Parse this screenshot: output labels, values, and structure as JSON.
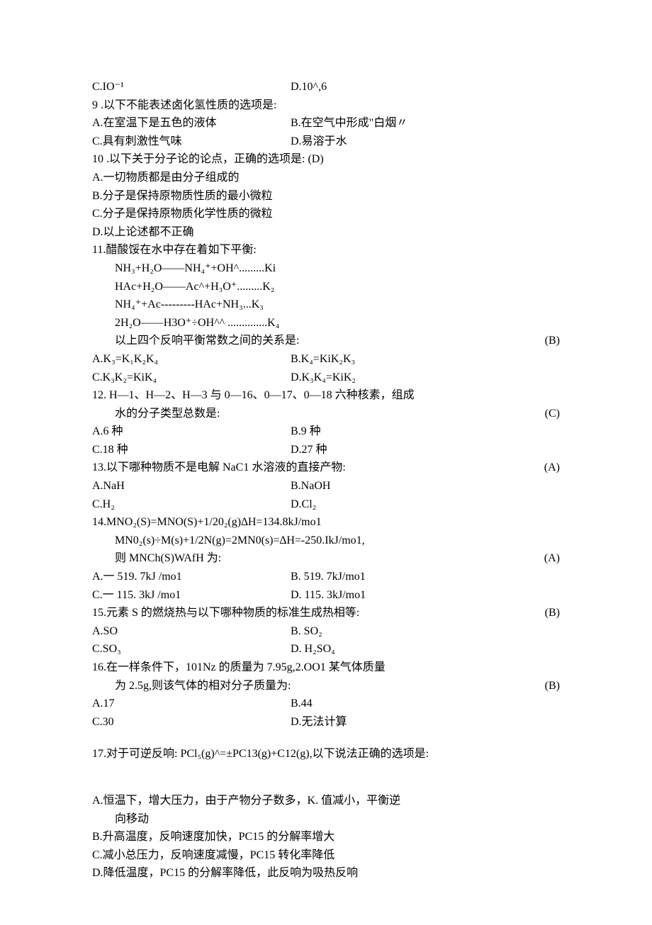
{
  "q8opt": {
    "c": "C.IO⁻¹",
    "d": "D.10^,6"
  },
  "q9": {
    "stem": "9 .以下不能表述卤化氢性质的选项是:",
    "a": "A.在室温下是五色的液体",
    "b": "B.在空气中形成\"白烟〃",
    "c": "C.具有刺激性气味",
    "d": "D.易溶于水"
  },
  "q10": {
    "stem": "10 .以下关于分子论的论点，正确的选项是: (D)",
    "a": "A.一切物质都是由分子组成的",
    "b": "B.分子是保持原物质性质的最小微粒",
    "c": "C.分子是保持原物质化学性质的微粒",
    "d": "D.以上论述都不正确"
  },
  "q11": {
    "stem": "11.醋酸馁在水中存在着如下平衡:",
    "e1": "NH₃+H₂O——NH₄⁺+OH^.........Ki",
    "e2": "HAc+H₂O——Ac^+H₃O⁺.........K₂",
    "e3": "NH₄⁺+Ac---------HAc+NH₃...K₃",
    "e4": "2H₂O——H3O⁺÷OH^^ ..............K₄",
    "rel": "以上四个反响平衡常数之间的关系是:",
    "a": "A.K₃=K₁K₂K₄",
    "b": "B.K₄=KiK₂K₃",
    "c": "C.K₃K₂=KiK₄",
    "d": "D.K₃K₄=KiK₂",
    "ans": "(B)"
  },
  "q12": {
    "stem1": "12. H—1、H—2、H—3 与 0—16、0—17、0—18 六种核素，组成",
    "stem2": "水的分子类型总数是:",
    "a": "A.6 种",
    "b": "B.9 种",
    "c": "C.18 种",
    "d": "D.27 种",
    "ans": "(C)"
  },
  "q13": {
    "stem": "13.以下哪种物质不是电解 NaC1 水溶液的直接产物:",
    "a": "A.NaH",
    "b": "B.NaOH",
    "c": "C.H₂",
    "d": "D.Cl₂",
    "ans": "(A)"
  },
  "q14": {
    "l1": "14.MNO₂(S)=MNO(S)+1/20₂(g)∆H=134.8kJ/mo1",
    "l2": "MN0₂(s)÷M(s)+1/2N(g)=2MN0(s)=∆H=-250.IkJ/mo1,",
    "l3": "则 MNCh(S)WAfH 为:",
    "a": "A.一 519.   7kJ /mo1",
    "b": "B.   519. 7kJ/mo1",
    "c": "C.一 115.   3kJ /mo1",
    "d": "D.   115. 3kJ/mo1",
    "ans": "(A)"
  },
  "q15": {
    "stem": "15.元素 S 的燃烧热与以下哪种物质的标准生成热相等:",
    "a": "A.SO",
    "b": "B.  SO₂",
    "c": "C.SO₃",
    "d": "D.  H₂SO₄",
    "ans": "(B)"
  },
  "q16": {
    "l1": "16.在一样条件下，101Nz 的质量为 7.95g,2.OO1 某气体质量",
    "l2": "为 2.5g,则该气体的相对分子质量为:",
    "a": "A.17",
    "b": "B.44",
    "c": "C.30",
    "d": "D.无法计算",
    "ans": "(B)"
  },
  "q17": {
    "stem": "17.对于可逆反响: PCl₅(g)^=±PC13(g)+C12(g),以下说法正确的选项是:",
    "a1": "A.恒温下，增大压力，由于产物分子数多，K. 值减小，平衡逆",
    "a2": "向移动",
    "b": "B.升高温度，反响速度加快，PC15 的分解率增大",
    "c": "C.减小总压力，反响速度减慢，PC15 转化率降低",
    "d": "D.降低温度，PC15 的分解率降低，此反响为吸热反响"
  }
}
